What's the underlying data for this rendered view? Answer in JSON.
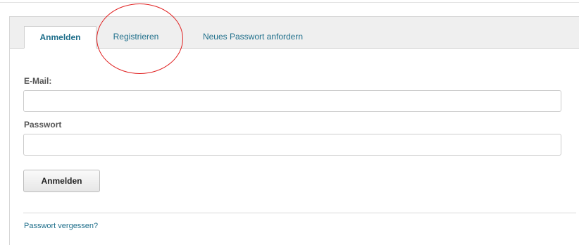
{
  "tabs": [
    {
      "label": "Anmelden",
      "active": true
    },
    {
      "label": "Registrieren",
      "active": false
    },
    {
      "label": "Neues Passwort anfordern",
      "active": false
    }
  ],
  "form": {
    "email_label": "E-Mail:",
    "email_value": "",
    "password_label": "Passwort",
    "password_value": "",
    "submit_label": "Anmelden"
  },
  "links": {
    "forgot_password": "Passwort vergessen?"
  },
  "colors": {
    "link": "#1f6f8b",
    "annotation": "#e02020",
    "tabbar_bg": "#efefef"
  }
}
